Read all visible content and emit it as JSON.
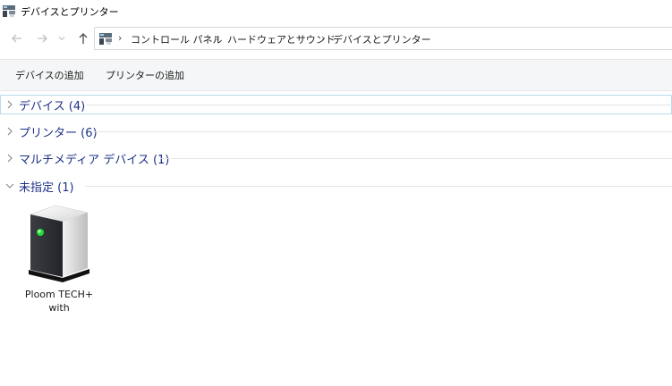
{
  "window": {
    "title": "デバイスとプリンター",
    "icon": "devices-printers-icon"
  },
  "navigation": {
    "back_icon": "arrow-left-icon",
    "forward_icon": "arrow-right-icon",
    "recent_icon": "chevron-down-icon",
    "up_icon": "arrow-up-icon"
  },
  "address_bar": {
    "icon": "devices-printers-icon",
    "breadcrumbs": [
      "コントロール パネル",
      "ハードウェアとサウンド",
      "デバイスとプリンター"
    ],
    "separator": "›"
  },
  "command_bar": {
    "add_device": "デバイスの追加",
    "add_printer": "プリンターの追加"
  },
  "groups": [
    {
      "label": "デバイス (4)",
      "expanded": false,
      "selected": true
    },
    {
      "label": "プリンター (6)",
      "expanded": false,
      "selected": false
    },
    {
      "label": "マルチメディア デバイス (1)",
      "expanded": false,
      "selected": false
    },
    {
      "label": "未指定 (1)",
      "expanded": true,
      "selected": false
    }
  ],
  "unspecified_devices": [
    {
      "name_line1": "Ploom TECH+",
      "name_line2": "with",
      "icon": "generic-device-icon"
    }
  ],
  "colors": {
    "group_label": "#1e3287",
    "selection_border": "#b7dcee",
    "command_bar_bg": "#f5f6f7",
    "device_led": "#22dd33"
  }
}
